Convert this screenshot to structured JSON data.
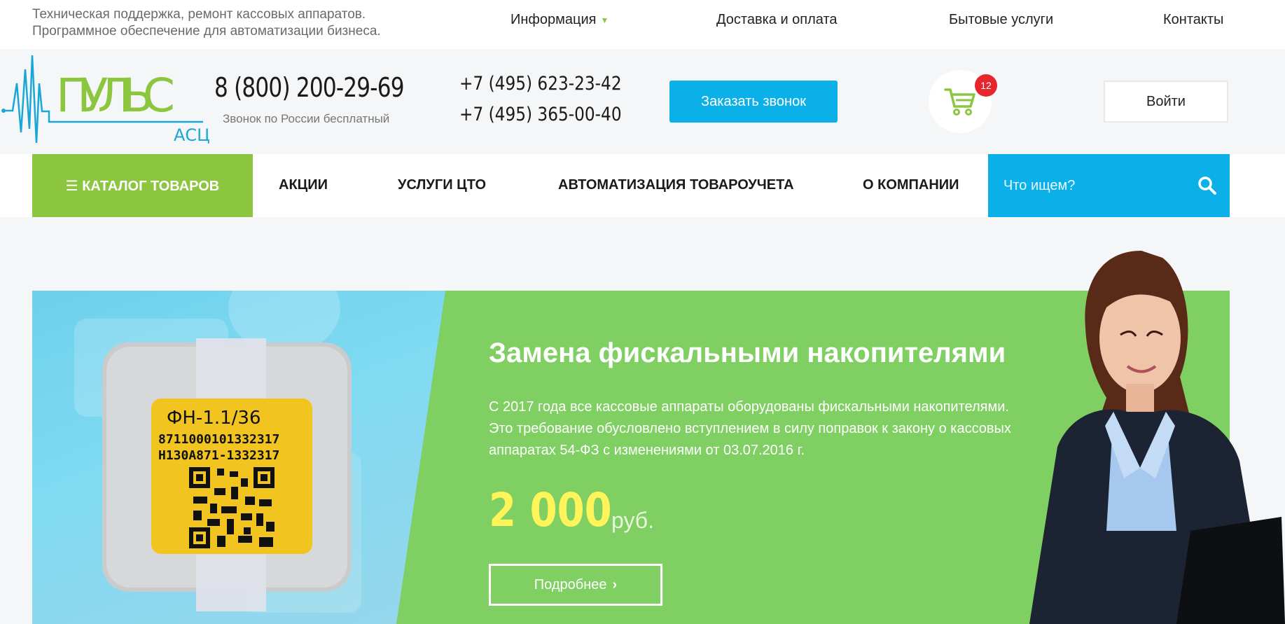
{
  "topbar": {
    "tagline_line1": "Техническая поддержка, ремонт кассовых аппаратов.",
    "tagline_line2": "Программное обеспечение для автоматизации бизнеса.",
    "nav": [
      {
        "label": "Информация",
        "icon": "chevron-down-icon"
      },
      {
        "label": "Доставка и оплата"
      },
      {
        "label": "Бытовые услуги"
      },
      {
        "label": "Контакты"
      }
    ]
  },
  "header": {
    "logo_text": "ПУЛЬС",
    "logo_sub": "АСЦ",
    "phone_main": "8 (800) 200-29-69",
    "phone_note": "Звонок по России бесплатный",
    "phone_alt_1": "+7 (495) 623-23-42",
    "phone_alt_2": "+7 (495) 365-00-40",
    "callback_label": "Заказать звонок",
    "cart_count": "12",
    "login_label": "Войти"
  },
  "mainnav": {
    "catalog_label": "☰ КАТАЛОГ ТОВАРОВ",
    "items": [
      {
        "label": "АКЦИИ"
      },
      {
        "label": "УСЛУГИ ЦТО"
      },
      {
        "label": "АВТОМАТИЗАЦИЯ ТОВАРОУЧЕТА"
      },
      {
        "label": "О КОМПАНИИ"
      }
    ],
    "search_placeholder": "Что ищем?"
  },
  "hero": {
    "title": "Замена фискальными накопителями",
    "text": "С 2017 года все кассовые аппараты оборудованы фискальными накопителями. Это требование обусловлено вступлением в силу поправок к закону о кассовых аппаратах 54-ФЗ с изменениями от 03.07.2016 г.",
    "price": "2 000",
    "currency": "руб.",
    "more_label": "Подробнее",
    "more_arrow": "›",
    "device_label_1": "ФН-1.1/36",
    "device_label_2": "8711000101332317",
    "device_label_3": "Н130А871-1332317"
  },
  "colors": {
    "green": "#8cc63f",
    "blue": "#0bb0e8",
    "badge": "#e5262d",
    "price": "#fff45a"
  }
}
